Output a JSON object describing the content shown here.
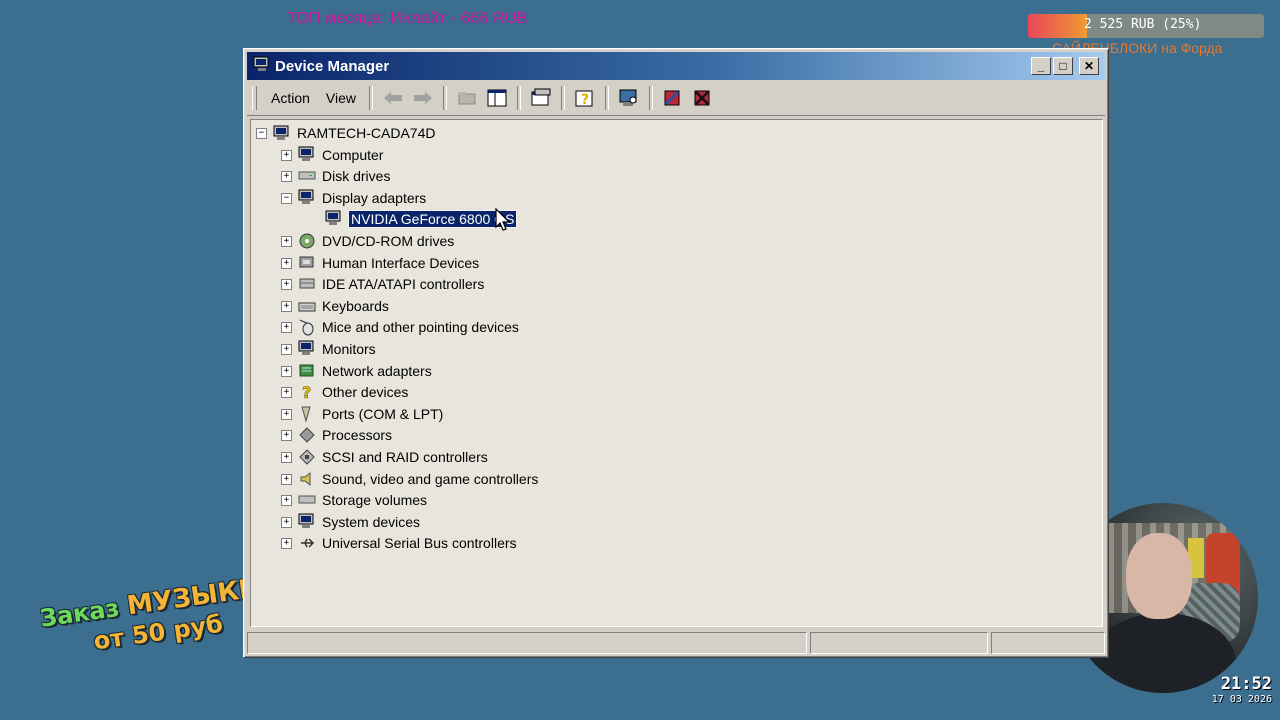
{
  "overlay": {
    "top_donor": "ТОП месяца:   Инлайт - 666 RUB",
    "goal_amount": "2 525 RUB (25%)",
    "goal_progress": 0.25,
    "goal_title": "САЙЛЕНБЛОКИ на Форда",
    "promo_line1_a": "Заказ ",
    "promo_line1_b": "МУЗЫКИ",
    "promo_line2": "от 50 руб",
    "clock_time": "21:52",
    "clock_date": "17 03 2026"
  },
  "window": {
    "title": "Device Manager",
    "menu": {
      "action": "Action",
      "view": "View"
    }
  },
  "tree": {
    "root": "RAMTECH-CADA74D",
    "categories": [
      {
        "label": "Computer",
        "icon": "computer-icon",
        "expanded": false
      },
      {
        "label": "Disk drives",
        "icon": "disk-drive-icon",
        "expanded": false
      },
      {
        "label": "Display adapters",
        "icon": "display-adapter-icon",
        "expanded": true
      },
      {
        "label": "DVD/CD-ROM drives",
        "icon": "cdrom-icon",
        "expanded": false
      },
      {
        "label": "Human Interface Devices",
        "icon": "hid-icon",
        "expanded": false
      },
      {
        "label": "IDE ATA/ATAPI controllers",
        "icon": "ide-controller-icon",
        "expanded": false
      },
      {
        "label": "Keyboards",
        "icon": "keyboard-icon",
        "expanded": false
      },
      {
        "label": "Mice and other pointing devices",
        "icon": "mouse-icon",
        "expanded": false
      },
      {
        "label": "Monitors",
        "icon": "monitor-icon",
        "expanded": false
      },
      {
        "label": "Network adapters",
        "icon": "network-adapter-icon",
        "expanded": false
      },
      {
        "label": "Other devices",
        "icon": "question-icon",
        "expanded": false
      },
      {
        "label": "Ports (COM & LPT)",
        "icon": "port-icon",
        "expanded": false
      },
      {
        "label": "Processors",
        "icon": "processor-icon",
        "expanded": false
      },
      {
        "label": "SCSI and RAID controllers",
        "icon": "scsi-icon",
        "expanded": false
      },
      {
        "label": "Sound, video and game controllers",
        "icon": "sound-icon",
        "expanded": false
      },
      {
        "label": "Storage volumes",
        "icon": "storage-icon",
        "expanded": false
      },
      {
        "label": "System devices",
        "icon": "system-icon",
        "expanded": false
      },
      {
        "label": "Universal Serial Bus controllers",
        "icon": "usb-icon",
        "expanded": false
      }
    ],
    "selected_device": "NVIDIA GeForce 6800 GS"
  },
  "colors": {
    "desktop": "#3b6e8f",
    "title_start": "#0a246a",
    "selection": "#0a246a"
  }
}
